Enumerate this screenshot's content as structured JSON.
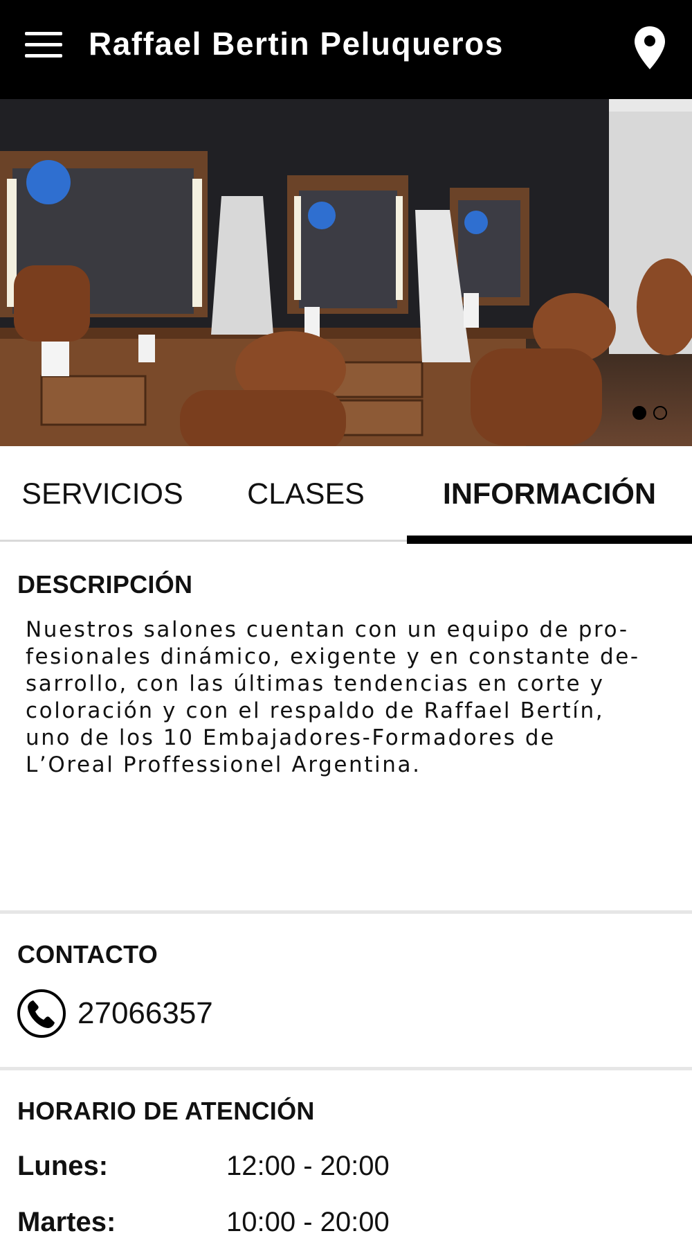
{
  "header": {
    "title": "Raffael Bertin Peluqueros",
    "menu_icon": "hamburger-menu-icon",
    "location_icon": "map-pin-icon",
    "background": "#000000"
  },
  "hero": {
    "image": "barbershop-interior-photo",
    "slide_count": 2,
    "active_slide": 1
  },
  "tabs": [
    {
      "label": "SERVICIOS",
      "active": false
    },
    {
      "label": "CLASES",
      "active": false
    },
    {
      "label": "INFORMACIÓN",
      "active": true
    }
  ],
  "descripcion": {
    "title": "DESCRIPCIÓN",
    "lines": [
      "Nuestros salones cuentan con un equipo de pro-",
      "fesionales dinámico, exigente y en constante de-",
      "sarrollo, con las últimas tendencias en corte y",
      "coloración y con el respaldo de Raffael Bertín,",
      "uno de los 10 Embajadores-Formadores de",
      "L’Oreal Proffessionel Argentina."
    ]
  },
  "contacto": {
    "title": "CONTACTO",
    "phone_icon": "phone-icon",
    "phone": "27066357"
  },
  "horario": {
    "title": "HORARIO DE ATENCIÓN",
    "rows": [
      {
        "day": "Lunes:",
        "time": "12:00 - 20:00"
      },
      {
        "day": "Martes:",
        "time": "10:00 - 20:00"
      }
    ]
  }
}
